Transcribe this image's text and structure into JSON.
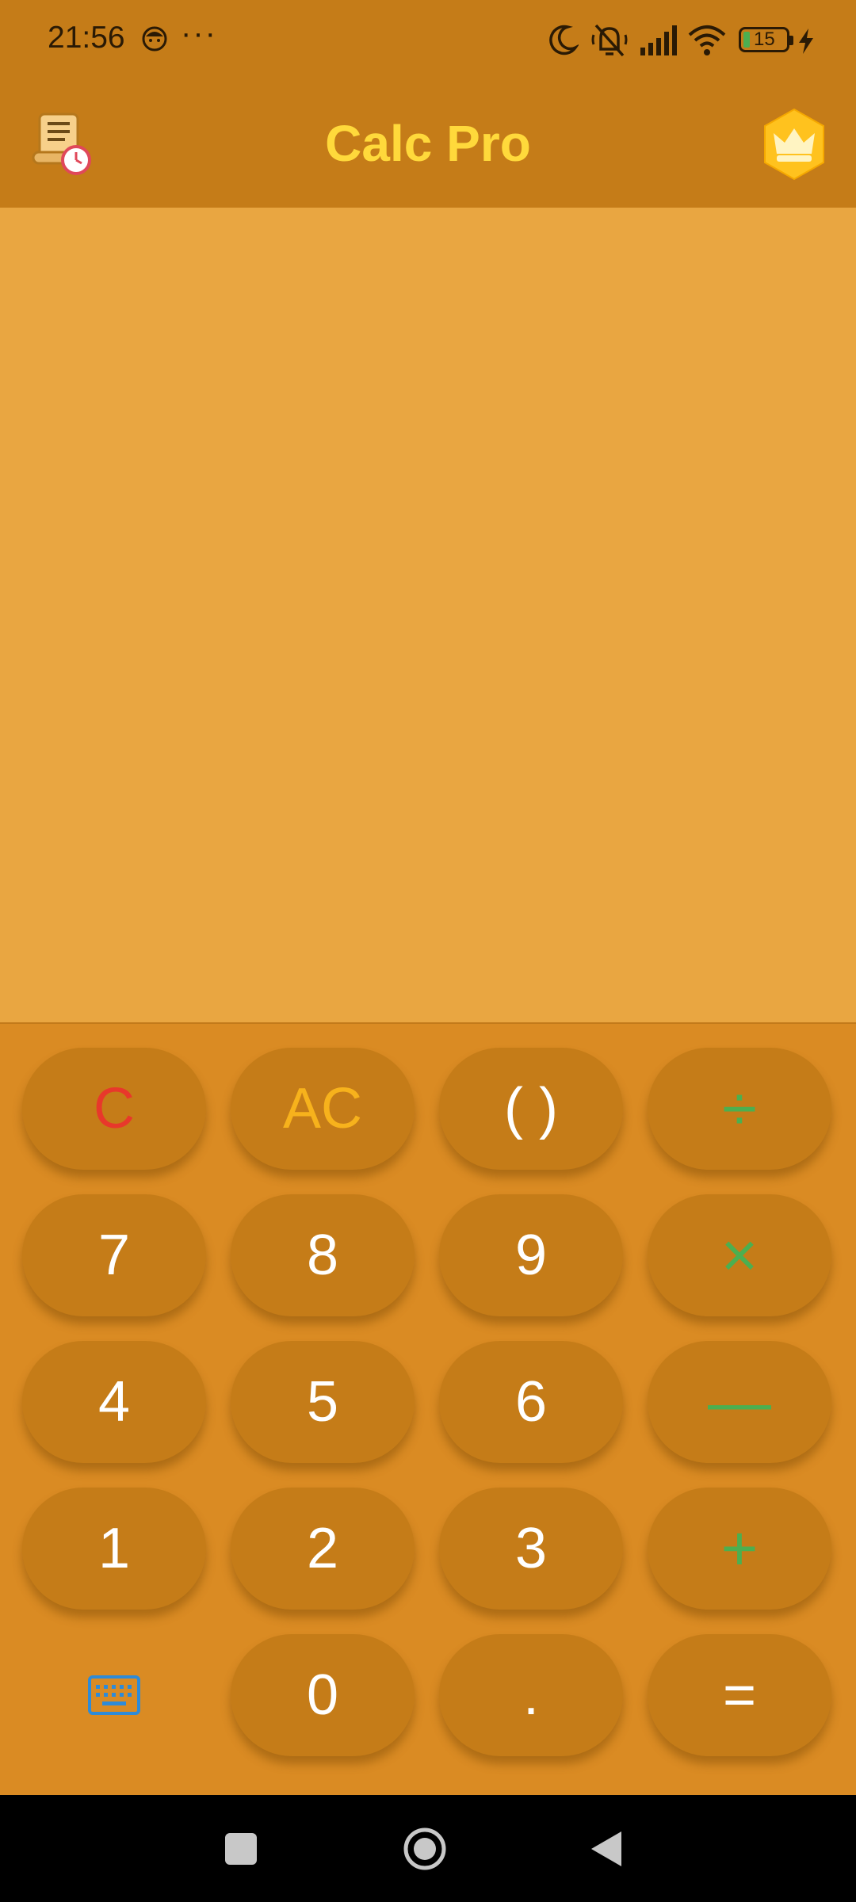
{
  "status_bar": {
    "time": "21:56",
    "dots": "···",
    "battery": "15"
  },
  "app_bar": {
    "title": "Calc Pro",
    "history_icon": "history-scroll-clock-icon",
    "premium_icon": "crown-hexagon-icon"
  },
  "display": {
    "expression": "",
    "result": ""
  },
  "keypad": {
    "row1": [
      "C",
      "AC",
      "( )",
      "÷"
    ],
    "row2": [
      "7",
      "8",
      "9",
      "×"
    ],
    "row3": [
      "4",
      "5",
      "6",
      "—"
    ],
    "row4": [
      "1",
      "2",
      "3",
      "+"
    ],
    "row5": [
      "0",
      ".",
      "="
    ],
    "keyboard_icon": "keyboard-icon"
  },
  "colors": {
    "bar": "#C57C18",
    "display_bg": "#E9A641",
    "keypad_bg": "#DA8B23",
    "key_bg": "#C57C18",
    "title": "#FFD93B",
    "clear": "#E8382B",
    "all_clear": "#F7B21C",
    "operator": "#4CAF50"
  }
}
